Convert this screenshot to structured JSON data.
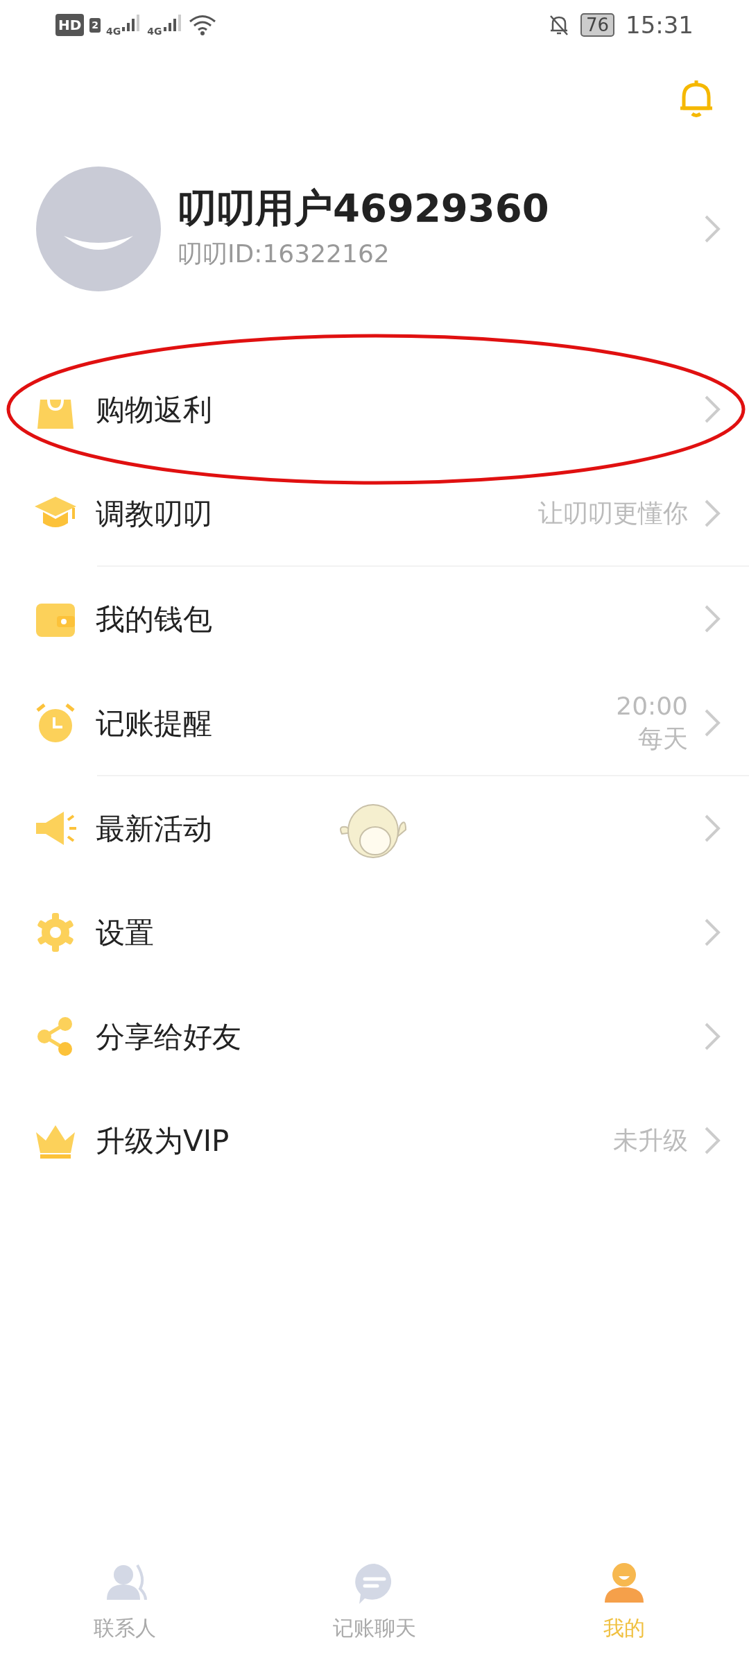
{
  "status_bar": {
    "hd": "HD",
    "sim": "2",
    "networks": [
      "4G",
      "4G"
    ],
    "battery": "76",
    "time": "15:31"
  },
  "profile": {
    "name": "叨叨用户46929360",
    "id": "叨叨ID:16322162"
  },
  "menu_groups": [
    {
      "items": [
        {
          "label": "购物返利",
          "highlighted": true
        },
        {
          "label": "调教叨叨",
          "detail": [
            "让叨叨更懂你"
          ],
          "highlighted": false
        }
      ]
    },
    {
      "items": [
        {
          "label": "我的钱包",
          "highlighted": false
        },
        {
          "label": "记账提醒",
          "detail": [
            "20:00",
            "每天"
          ],
          "highlighted": false
        }
      ]
    },
    {
      "items": [
        {
          "label": "最新活动",
          "highlighted": false
        },
        {
          "label": "设置",
          "highlighted": false
        },
        {
          "label": "分享给好友",
          "highlighted": false
        },
        {
          "label": "升级为VIP",
          "detail": [
            "未升级"
          ],
          "highlighted": false
        }
      ]
    }
  ],
  "tabs": [
    {
      "label": "联系人",
      "selected": false
    },
    {
      "label": "记账聊天",
      "selected": false
    },
    {
      "label": "我的",
      "selected": true
    }
  ]
}
